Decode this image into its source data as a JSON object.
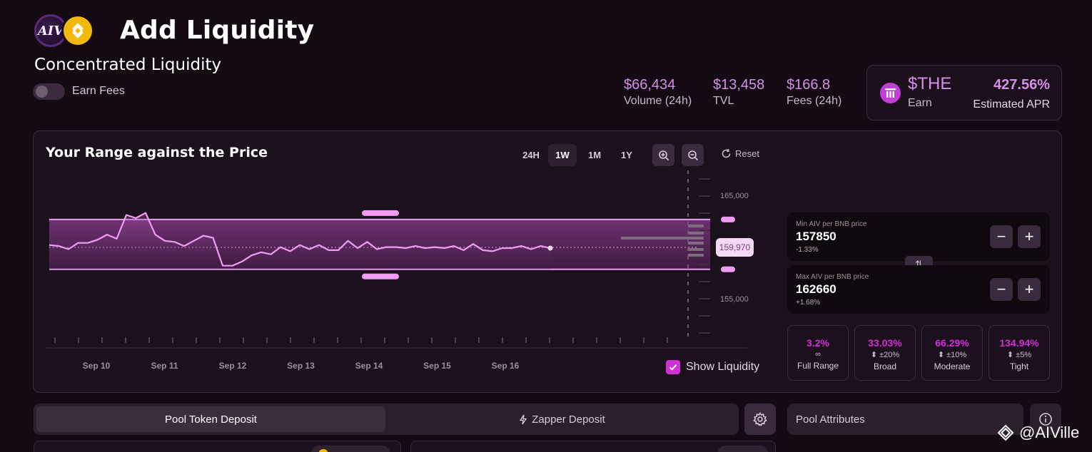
{
  "header": {
    "logo_text": "AIV",
    "title": "Add Liquidity",
    "subtitle": "Concentrated Liquidity",
    "earn_fees_label": "Earn Fees"
  },
  "stats": [
    {
      "value": "$66,434",
      "label": "Volume (24h)"
    },
    {
      "value": "$13,458",
      "label": "TVL"
    },
    {
      "value": "$166.8",
      "label": "Fees (24h)"
    }
  ],
  "earn_box": {
    "token": "$THE",
    "earn_label": "Earn",
    "apr": "427.56%",
    "apr_label": "Estimated APR"
  },
  "chart_panel": {
    "title": "Your Range against the Price",
    "timeframes": [
      "24H",
      "1W",
      "1M",
      "1Y"
    ],
    "active_timeframe": "1W",
    "reset_label": "Reset",
    "show_liquidity_label": "Show Liquidity",
    "current_price_label": "159,970"
  },
  "chart_data": {
    "type": "line",
    "x_ticks": [
      "Sep 10",
      "Sep 11",
      "Sep 12",
      "Sep 13",
      "Sep 14",
      "Sep 15",
      "Sep 16"
    ],
    "y_ticks": [
      165000,
      155000
    ],
    "ylim": [
      150400,
      168300
    ],
    "y_tick_labels": [
      "165,000",
      "155,000"
    ],
    "range_min": 157850,
    "range_max": 162660,
    "current_price": 159970,
    "price_series": [
      160200,
      160100,
      159800,
      160400,
      160400,
      160700,
      161200,
      160800,
      163100,
      162800,
      163300,
      161200,
      160600,
      160500,
      160100,
      160600,
      161100,
      160900,
      158200,
      158200,
      158600,
      159200,
      159500,
      159300,
      160000,
      159600,
      160200,
      159800,
      160200,
      159700,
      159700,
      160600,
      159900,
      160500,
      159800,
      160000,
      160000,
      159900,
      160100,
      159900,
      160000,
      159900,
      160100,
      159700,
      160300,
      159700,
      159600,
      159900,
      159900,
      160100,
      159800,
      160100,
      159900
    ]
  },
  "price_inputs": [
    {
      "label": "Min AIV per BNB price",
      "value": "157850",
      "pct": "-1.33%"
    },
    {
      "label": "Max AIV per BNB price",
      "value": "162660",
      "pct": "+1.68%"
    }
  ],
  "presets": [
    {
      "value": "3.2%",
      "icon": "∞",
      "name": "Full Range"
    },
    {
      "value": "33.03%",
      "icon": "±20%",
      "name": "Broad"
    },
    {
      "value": "66.29%",
      "icon": "±10%",
      "name": "Moderate"
    },
    {
      "value": "134.94%",
      "icon": "±5%",
      "name": "Tight"
    }
  ],
  "bottom": {
    "tabs": [
      "Pool Token Deposit",
      "Zapper Deposit"
    ],
    "attributes_label": "Pool Attributes"
  },
  "watermark": "@AIVille",
  "colors": {
    "accent": "#d58fe6",
    "magenta": "#d32fd6",
    "range_line": "#e79cf0",
    "bnb": "#f0b90b"
  }
}
